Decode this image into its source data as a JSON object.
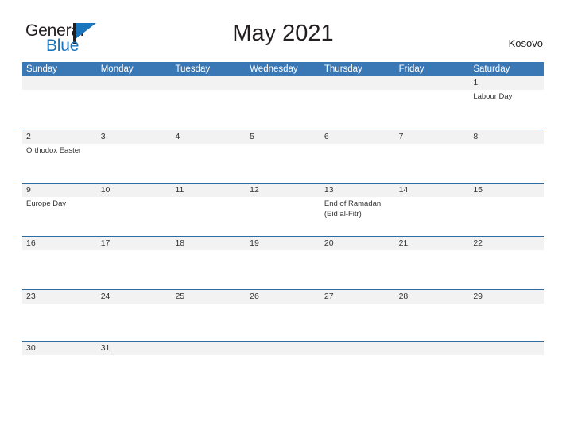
{
  "brand": {
    "name_part1": "General",
    "name_part2": "Blue",
    "triangle_color": "#1b75bb"
  },
  "header": {
    "title": "May 2021",
    "country": "Kosovo"
  },
  "theme": {
    "header_blue": "#3a78b5",
    "rule_blue": "#2e6da4",
    "band_gray": "#f2f2f2",
    "text_dark": "#333333"
  },
  "weekdays": [
    "Sunday",
    "Monday",
    "Tuesday",
    "Wednesday",
    "Thursday",
    "Friday",
    "Saturday"
  ],
  "weeks": [
    {
      "days": [
        {
          "num": "",
          "events": []
        },
        {
          "num": "",
          "events": []
        },
        {
          "num": "",
          "events": []
        },
        {
          "num": "",
          "events": []
        },
        {
          "num": "",
          "events": []
        },
        {
          "num": "",
          "events": []
        },
        {
          "num": "1",
          "events": [
            "Labour Day"
          ]
        }
      ]
    },
    {
      "days": [
        {
          "num": "2",
          "events": [
            "Orthodox Easter"
          ]
        },
        {
          "num": "3",
          "events": []
        },
        {
          "num": "4",
          "events": []
        },
        {
          "num": "5",
          "events": []
        },
        {
          "num": "6",
          "events": []
        },
        {
          "num": "7",
          "events": []
        },
        {
          "num": "8",
          "events": []
        }
      ]
    },
    {
      "days": [
        {
          "num": "9",
          "events": [
            "Europe Day"
          ]
        },
        {
          "num": "10",
          "events": []
        },
        {
          "num": "11",
          "events": []
        },
        {
          "num": "12",
          "events": []
        },
        {
          "num": "13",
          "events": [
            "End of Ramadan",
            "(Eid al-Fitr)"
          ]
        },
        {
          "num": "14",
          "events": []
        },
        {
          "num": "15",
          "events": []
        }
      ]
    },
    {
      "days": [
        {
          "num": "16",
          "events": []
        },
        {
          "num": "17",
          "events": []
        },
        {
          "num": "18",
          "events": []
        },
        {
          "num": "19",
          "events": []
        },
        {
          "num": "20",
          "events": []
        },
        {
          "num": "21",
          "events": []
        },
        {
          "num": "22",
          "events": []
        }
      ]
    },
    {
      "days": [
        {
          "num": "23",
          "events": []
        },
        {
          "num": "24",
          "events": []
        },
        {
          "num": "25",
          "events": []
        },
        {
          "num": "26",
          "events": []
        },
        {
          "num": "27",
          "events": []
        },
        {
          "num": "28",
          "events": []
        },
        {
          "num": "29",
          "events": []
        }
      ]
    },
    {
      "days": [
        {
          "num": "30",
          "events": []
        },
        {
          "num": "31",
          "events": []
        },
        {
          "num": "",
          "events": []
        },
        {
          "num": "",
          "events": []
        },
        {
          "num": "",
          "events": []
        },
        {
          "num": "",
          "events": []
        },
        {
          "num": "",
          "events": []
        }
      ]
    }
  ]
}
